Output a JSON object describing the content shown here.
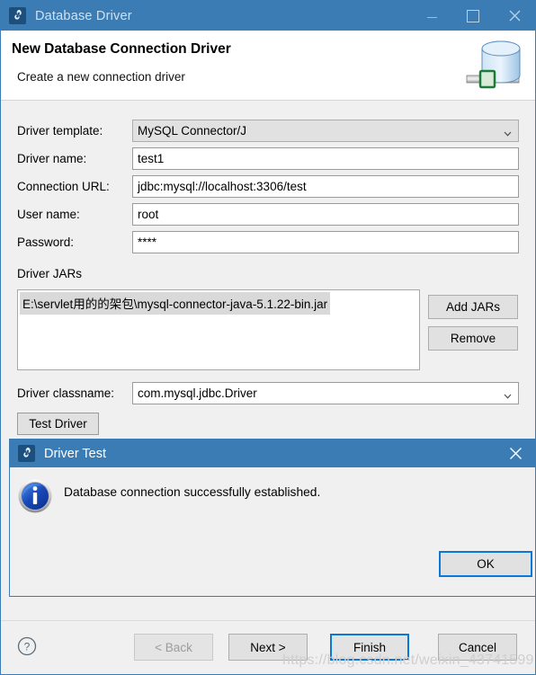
{
  "window": {
    "title": "Database Driver",
    "icon": "eclipse-datatools-icon",
    "controls": {
      "minimize": "minimize-icon",
      "maximize": "maximize-icon",
      "close": "close-icon"
    }
  },
  "header": {
    "title": "New Database Connection Driver",
    "subtitle": "Create a new connection driver",
    "icon": "database-cylinder-icon"
  },
  "form": {
    "rows": [
      {
        "label": "Driver template:",
        "value": "MySQL Connector/J",
        "type": "combo"
      },
      {
        "label": "Driver name:",
        "value": "test1",
        "type": "text"
      },
      {
        "label": "Connection URL:",
        "value": "jdbc:mysql://localhost:3306/test",
        "type": "text"
      },
      {
        "label": "User name:",
        "value": "root",
        "type": "text"
      },
      {
        "label": "Password:",
        "value": "****",
        "type": "password"
      }
    ],
    "jars": {
      "group_label": "Driver JARs",
      "items": [
        "E:\\servlet用的的架包\\mysql-connector-java-5.1.22-bin.jar"
      ],
      "add_label": "Add JARs",
      "remove_label": "Remove"
    },
    "classname": {
      "label": "Driver classname:",
      "value": "com.mysql.jdbc.Driver"
    },
    "test_driver_label": "Test Driver"
  },
  "footer": {
    "help_icon": "help-question-icon",
    "buttons": {
      "back": "< Back",
      "next": "Next >",
      "finish": "Finish",
      "cancel": "Cancel"
    }
  },
  "modal": {
    "title": "Driver Test",
    "icon": "eclipse-datatools-icon",
    "close": "close-icon",
    "status_icon": "info-icon",
    "message": "Database connection successfully established.",
    "ok_label": "OK"
  },
  "watermark": "https://blog.csdn.net/weixin_43741599",
  "colors": {
    "titlebar": "#3b7cb5",
    "dialog_bg": "#f0f0f0",
    "focus_border": "#0a78d7",
    "info_blue": "#1e56c8",
    "selection_gray": "#d9d9d9"
  }
}
